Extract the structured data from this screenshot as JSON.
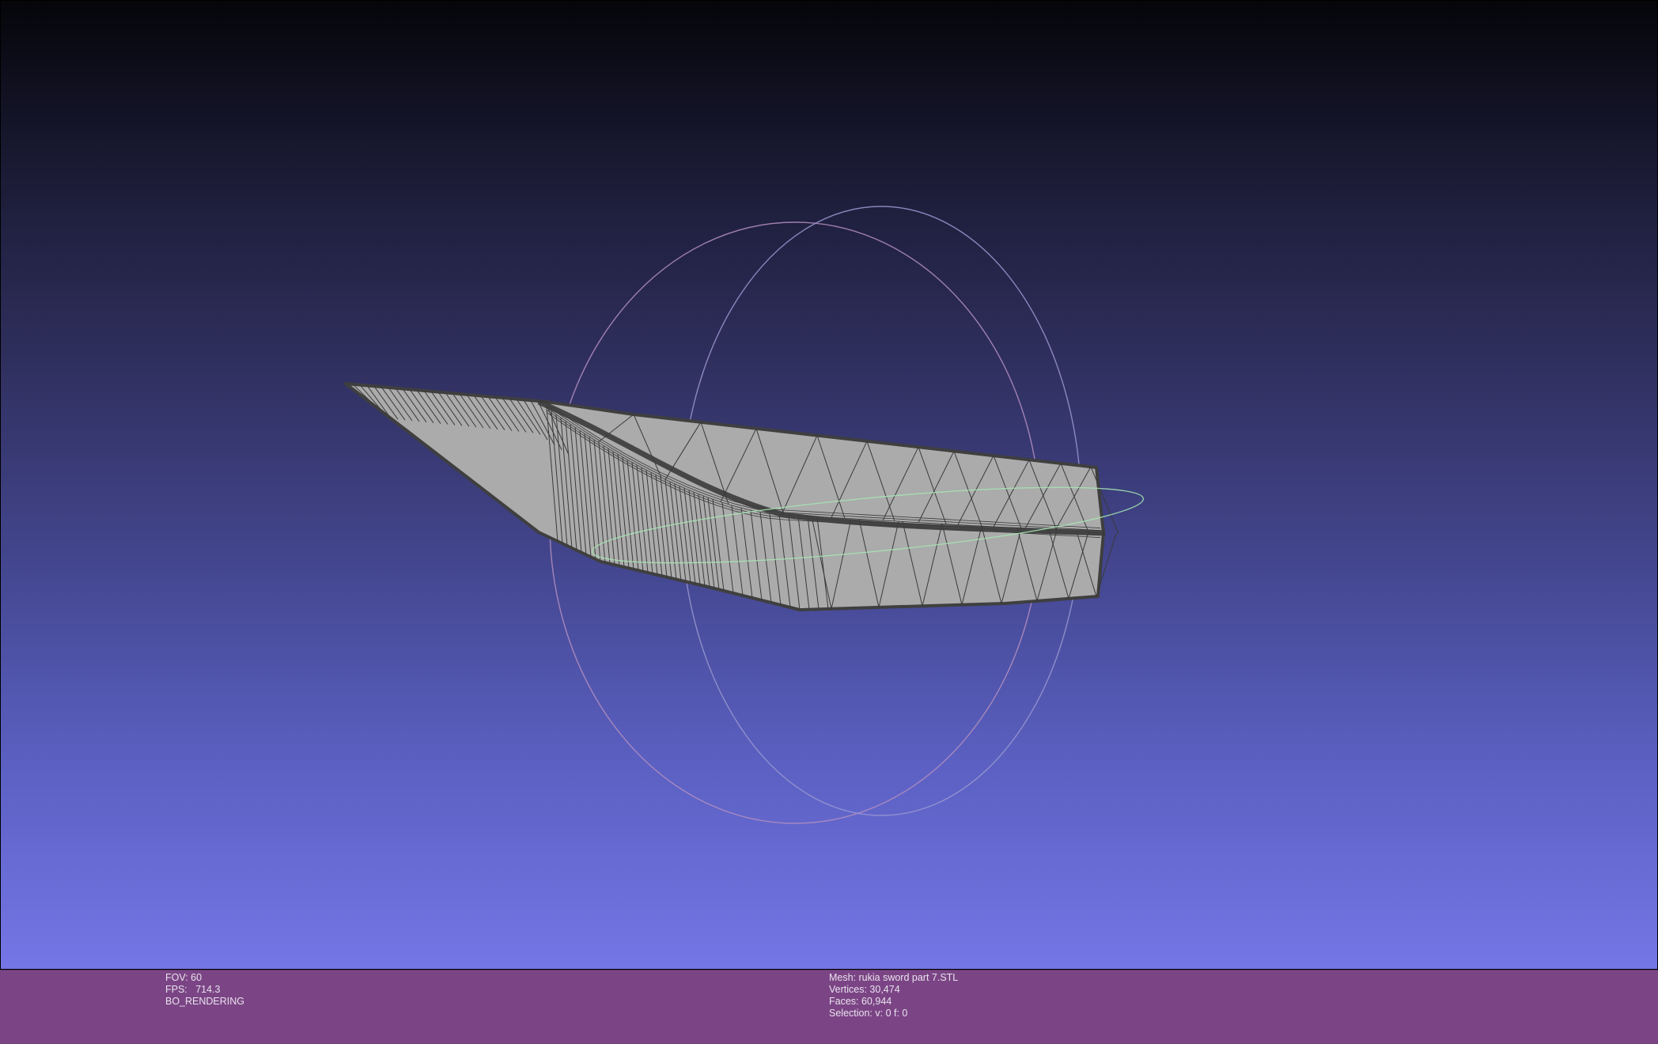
{
  "viewer": {
    "background_top": "#05050a",
    "background_bottom": "#7476e6",
    "mesh_fill": "#ababab",
    "mesh_edge": "#3a3a3a",
    "trackball_colors": [
      "#c98fbf",
      "#8f8fc8",
      "#9fe0a8"
    ]
  },
  "status": {
    "color": "#7b4585",
    "fov": "FOV: 60",
    "fps": "FPS:   714.3",
    "render_mode": "BO_RENDERING",
    "mesh": "Mesh: rukia sword part 7.STL",
    "vertices": "Vertices: 30,474",
    "faces": "Faces: 60,944",
    "selection": "Selection: v: 0 f: 0"
  }
}
